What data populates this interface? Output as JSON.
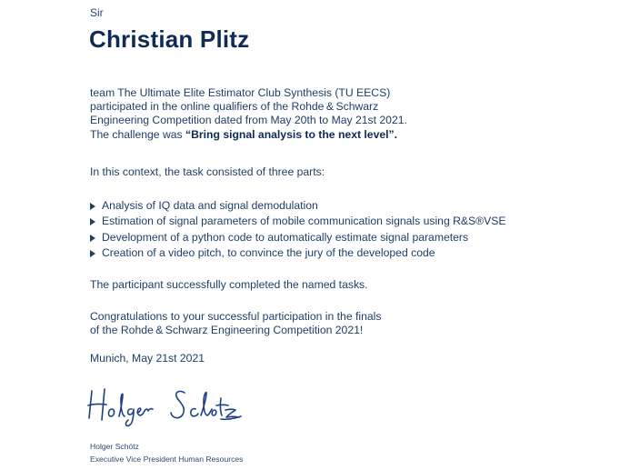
{
  "letter": {
    "salutation": "Sir",
    "name": "Christian Plitz",
    "intro": {
      "line1": "team The Ultimate Elite Estimator Club Synthesis (TU EECS)",
      "line2": "participated in the online qualifiers of the Rohde & Schwarz",
      "line3": "Engineering Competition dated from May 20th to May 21st 2021.",
      "line4_prefix": "The challenge was ",
      "line4_bold": "“Bring signal analysis to the next level”."
    },
    "context": "In this context, the task consisted of three parts:",
    "tasks": [
      "Analysis of IQ data and signal demodulation",
      "Estimation of signal parameters of mobile communication signals using R&S®VSE",
      "Development of a python code to automatically estimate signal parameters",
      "Creation of a video pitch, to convince the jury of the developed code"
    ],
    "completed": "The participant successfully completed the named tasks.",
    "congrats": {
      "line1": "Congratulations to your successful participation in the finals",
      "line2": "of the Rohde & Schwarz Engineering Competition 2021!"
    },
    "place_date": "Munich, May 21st 2021",
    "signatory": {
      "name": "Holger Schötz",
      "title": "Executive Vice President Human Resources",
      "signature_text": "Holger Schötz"
    }
  },
  "colors": {
    "text": "#1f3e68",
    "heading": "#0e2a55"
  }
}
